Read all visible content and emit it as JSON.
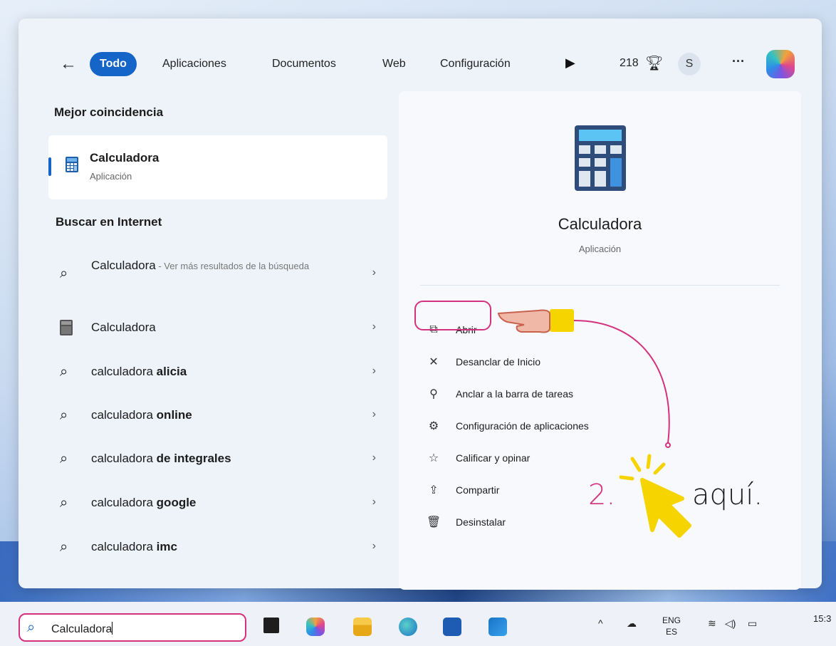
{
  "nav": {
    "tabs": [
      {
        "label": "Todo",
        "active": true
      },
      {
        "label": "Aplicaciones",
        "active": false
      },
      {
        "label": "Documentos",
        "active": false
      },
      {
        "label": "Web",
        "active": false
      },
      {
        "label": "Configuración",
        "active": false
      }
    ],
    "points": "218",
    "avatar_letter": "S",
    "more": "···"
  },
  "left": {
    "best_match_title": "Mejor coincidencia",
    "best_match": {
      "name": "Calculadora",
      "type": "Aplicación"
    },
    "internet_title": "Buscar en Internet",
    "results": [
      {
        "prefix": "Calculadora",
        "bold": "",
        "hint": " - Ver más resultados de la búsqueda",
        "icon": "search-icon"
      },
      {
        "prefix": "Calculadora",
        "bold": "",
        "hint": "",
        "icon": "calculator-app-icon"
      },
      {
        "prefix": "calculadora ",
        "bold": "alicia",
        "hint": "",
        "icon": "search-icon"
      },
      {
        "prefix": "calculadora ",
        "bold": "online",
        "hint": "",
        "icon": "search-icon"
      },
      {
        "prefix": "calculadora ",
        "bold": "de integrales",
        "hint": "",
        "icon": "search-icon"
      },
      {
        "prefix": "calculadora ",
        "bold": "google",
        "hint": "",
        "icon": "search-icon"
      },
      {
        "prefix": "calculadora ",
        "bold": "imc",
        "hint": "",
        "icon": "search-icon"
      }
    ]
  },
  "detail": {
    "name": "Calculadora",
    "type": "Aplicación",
    "actions": [
      {
        "label": "Abrir",
        "icon": "open-external-icon"
      },
      {
        "label": "Desanclar de Inicio",
        "icon": "unpin-icon"
      },
      {
        "label": "Anclar a la barra de tareas",
        "icon": "pin-icon"
      },
      {
        "label": "Configuración de aplicaciones",
        "icon": "gear-icon"
      },
      {
        "label": "Calificar y opinar",
        "icon": "rate-star-icon"
      },
      {
        "label": "Compartir",
        "icon": "share-icon"
      },
      {
        "label": "Desinstalar",
        "icon": "trash-icon"
      }
    ]
  },
  "annotation": {
    "number": "2.",
    "word": "aquí."
  },
  "taskbar": {
    "search_value": "Calculadora",
    "lang_top": "ENG",
    "lang_bottom": "ES",
    "clock": "15:3"
  },
  "colors": {
    "accent": "#1565c8",
    "annotation": "#d4317e",
    "pointer": "#f5d400"
  }
}
